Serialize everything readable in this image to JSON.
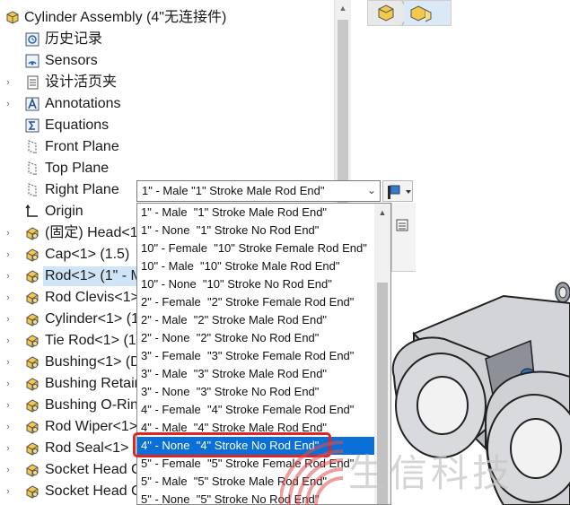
{
  "tree": {
    "items": [
      {
        "label": "Cylinder Assembly  (4\"无连接件)",
        "icon": "assembly-icon",
        "arrow": "",
        "indent": 0
      },
      {
        "label": "历史记录",
        "icon": "history-icon",
        "arrow": "",
        "indent": 1
      },
      {
        "label": "Sensors",
        "icon": "sensors-icon",
        "arrow": "",
        "indent": 1
      },
      {
        "label": "设计活页夹",
        "icon": "design-binder-icon",
        "arrow": "›",
        "indent": 1
      },
      {
        "label": "Annotations",
        "icon": "annotations-icon",
        "arrow": "›",
        "indent": 1
      },
      {
        "label": "Equations",
        "icon": "equations-icon",
        "arrow": "",
        "indent": 1
      },
      {
        "label": "Front Plane",
        "icon": "plane-icon",
        "arrow": "",
        "indent": 1
      },
      {
        "label": "Top Plane",
        "icon": "plane-icon",
        "arrow": "",
        "indent": 1
      },
      {
        "label": "Right Plane",
        "icon": "plane-icon",
        "arrow": "",
        "indent": 1
      },
      {
        "label": "Origin",
        "icon": "origin-icon",
        "arrow": "",
        "indent": 1
      },
      {
        "label": "(固定) Head<1",
        "icon": "part-icon",
        "arrow": "›",
        "indent": 1
      },
      {
        "label": "Cap<1> (1.5)",
        "icon": "part-icon",
        "arrow": "›",
        "indent": 1
      },
      {
        "label": "Rod<1> (1\" - M",
        "icon": "part-icon",
        "arrow": "›",
        "indent": 1,
        "selected": true
      },
      {
        "label": "Rod Clevis<1>",
        "icon": "part-icon",
        "arrow": "›",
        "indent": 1
      },
      {
        "label": "Cylinder<1> (1",
        "icon": "part-icon",
        "arrow": "›",
        "indent": 1
      },
      {
        "label": "Tie Rod<1> (1",
        "icon": "part-icon",
        "arrow": "›",
        "indent": 1
      },
      {
        "label": "Bushing<1> (D",
        "icon": "part-icon",
        "arrow": "›",
        "indent": 1
      },
      {
        "label": "Bushing Retain",
        "icon": "part-icon",
        "arrow": "›",
        "indent": 1
      },
      {
        "label": "Bushing O-Rin",
        "icon": "part-icon",
        "arrow": "›",
        "indent": 1
      },
      {
        "label": "Rod Wiper<1>",
        "icon": "part-icon",
        "arrow": "›",
        "indent": 1
      },
      {
        "label": "Rod Seal<1>",
        "icon": "part-icon",
        "arrow": "›",
        "indent": 1
      },
      {
        "label": "Socket Head C",
        "icon": "part-icon",
        "arrow": "›",
        "indent": 1
      },
      {
        "label": "Socket Head C",
        "icon": "part-icon",
        "arrow": "›",
        "indent": 1
      }
    ]
  },
  "config_dropdown": {
    "selected_value": "1\" - Male  \"1\" Stroke Male Rod End\"",
    "options": [
      "1\" - Male  \"1\" Stroke Male Rod End\"",
      "1\" - None  \"1\" Stroke No Rod End\"",
      "10\" - Female  \"10\" Stroke Female Rod End\"",
      "10\" - Male  \"10\" Stroke Male Rod End\"",
      "10\" - None  \"10\" Stroke No Rod End\"",
      "2\" - Female  \"2\" Stroke Female Rod End\"",
      "2\" - Male  \"2\" Stroke Male Rod End\"",
      "2\" - None  \"2\" Stroke No Rod End\"",
      "3\" - Female  \"3\" Stroke Female Rod End\"",
      "3\" - Male  \"3\" Stroke Male Rod End\"",
      "3\" - None  \"3\" Stroke No Rod End\"",
      "4\" - Female  \"4\" Stroke Female Rod End\"",
      "4\" - Male  \"4\" Stroke Male Rod End\"",
      "4\" - None  \"4\" Stroke No Rod End\"",
      "5\" - Female  \"5\" Stroke Female Rod End\"",
      "5\" - Male  \"5\" Stroke Male Rod End\"",
      "5\" - None  \"5\" Stroke No Rod End\""
    ],
    "highlighted_index": 13
  },
  "watermark": {
    "text": "生信科技",
    "logo": "wifi-logo-icon"
  },
  "colors": {
    "selection": "#0a6fd6",
    "highlight_box": "#e02424",
    "tree_selected": "#cfe4f7"
  }
}
